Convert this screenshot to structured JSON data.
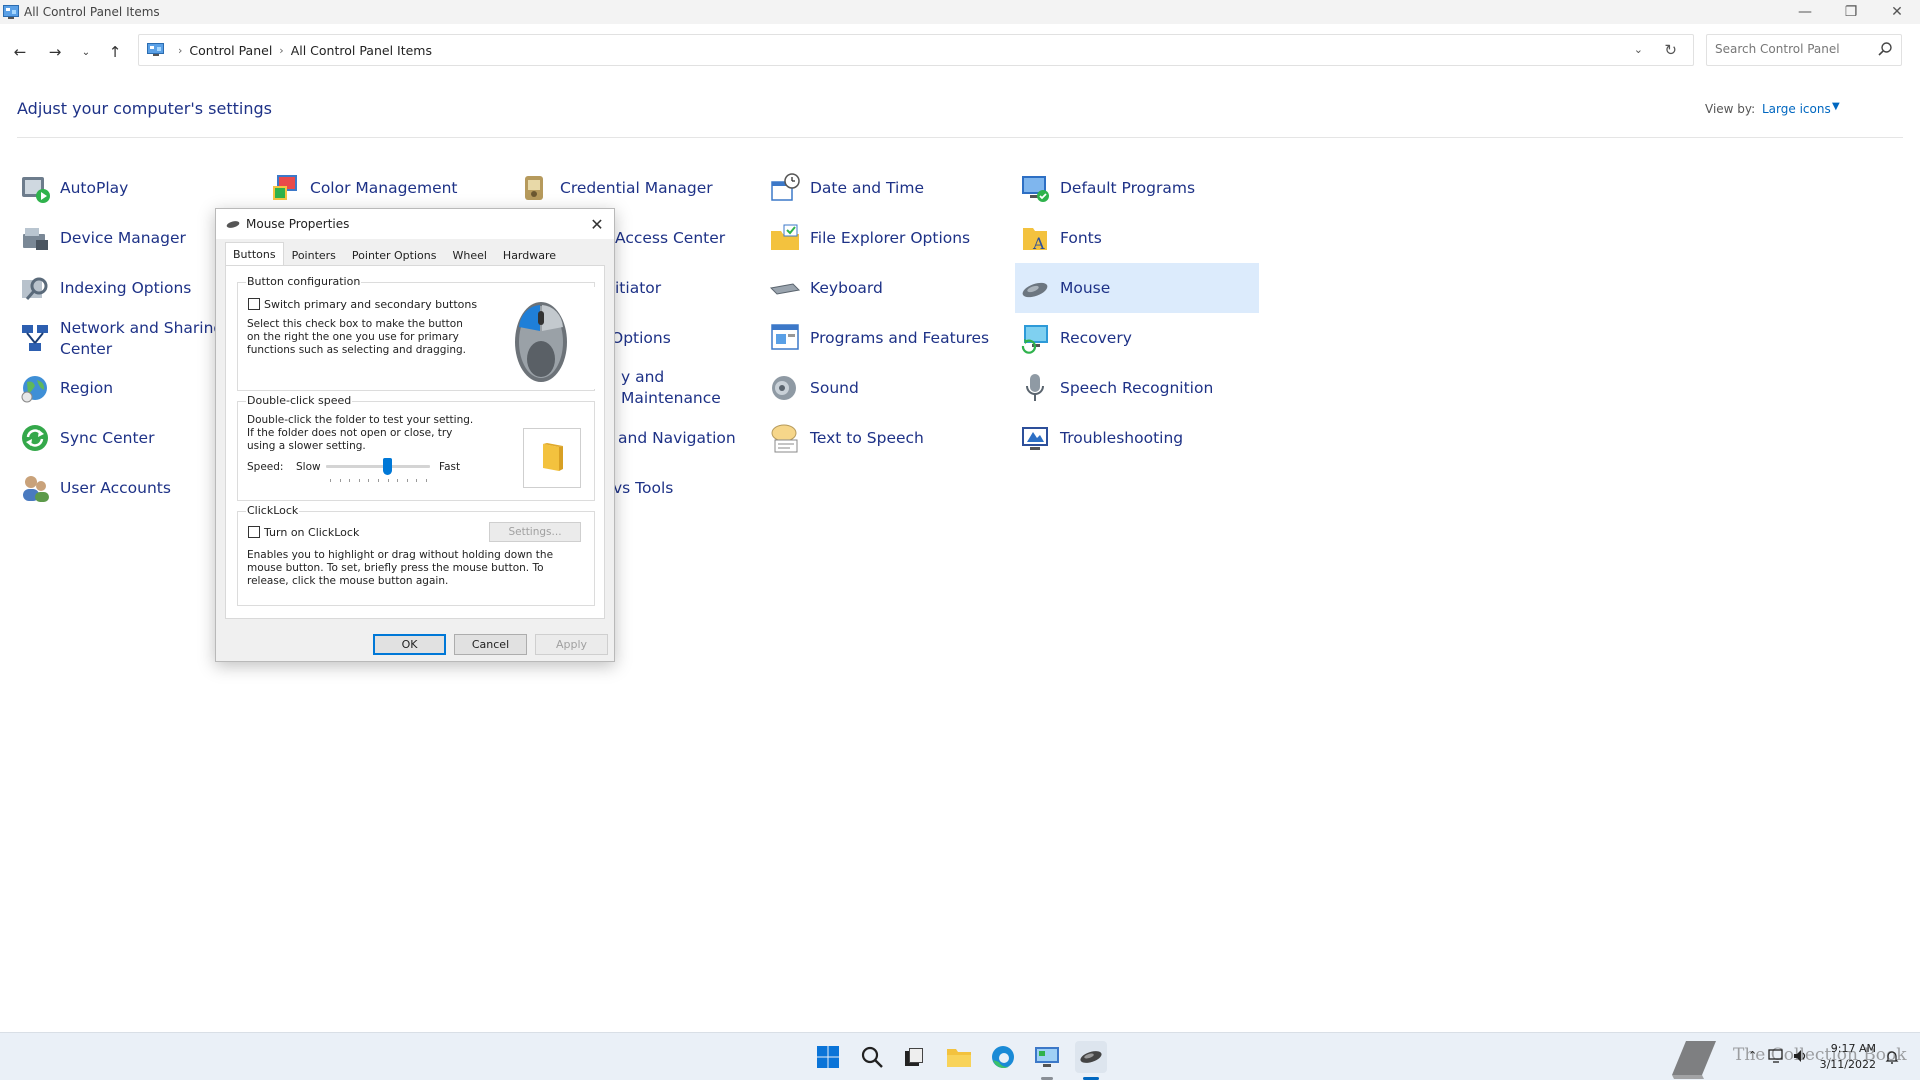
{
  "window": {
    "title": "All Control Panel Items"
  },
  "address": {
    "crumbs": [
      "Control Panel",
      "All Control Panel Items"
    ],
    "search_placeholder": "Search Control Panel"
  },
  "header": {
    "heading": "Adjust your computer's settings",
    "view_by_label": "View by:",
    "view_by_value": "Large icons"
  },
  "items": {
    "autoplay": "AutoPlay",
    "color_management": "Color Management",
    "credential_manager": "Credential Manager",
    "date_time": "Date and Time",
    "default_programs": "Default Programs",
    "device_manager": "Device Manager",
    "ease_access_partial": "Access Center",
    "file_explorer_options": "File Explorer Options",
    "fonts": "Fonts",
    "indexing_options": "Indexing Options",
    "iscsi_partial": "itiator",
    "keyboard": "Keyboard",
    "mouse": "Mouse",
    "network_sharing_line1": "Network and Sharing",
    "network_sharing_line2": "Center",
    "power_options_partial": "Options",
    "programs_features": "Programs and Features",
    "recovery": "Recovery",
    "region": "Region",
    "security_maintenance_partial": "y and Maintenance",
    "sound": "Sound",
    "speech_recognition": "Speech Recognition",
    "sync_center": "Sync Center",
    "taskbar_navigation_partial": "and Navigation",
    "text_to_speech": "Text to Speech",
    "troubleshooting": "Troubleshooting",
    "user_accounts": "User Accounts",
    "windows_tools_partial": "vs Tools"
  },
  "dialog": {
    "title": "Mouse Properties",
    "tabs": [
      "Buttons",
      "Pointers",
      "Pointer Options",
      "Wheel",
      "Hardware"
    ],
    "button_config": {
      "label": "Button configuration",
      "checkbox_label": "Switch primary and secondary buttons",
      "description": "Select this check box to make the button on the right the one you use for primary functions such as selecting and dragging."
    },
    "double_click": {
      "label": "Double-click speed",
      "description": "Double-click the folder to test your setting. If the folder does not open or close, try using a slower setting.",
      "speed_label": "Speed:",
      "slow": "Slow",
      "fast": "Fast",
      "speed_fraction": 0.6
    },
    "clicklock": {
      "label": "ClickLock",
      "checkbox_label": "Turn on ClickLock",
      "settings_button": "Settings...",
      "description": "Enables you to highlight or drag without holding down the mouse button. To set, briefly press the mouse button. To release, click the mouse button again."
    },
    "buttons": {
      "ok": "OK",
      "cancel": "Cancel",
      "apply": "Apply"
    }
  },
  "taskbar": {
    "time": "9:17 AM",
    "date": "3/11/2022",
    "watermark": "The Collection Book"
  }
}
